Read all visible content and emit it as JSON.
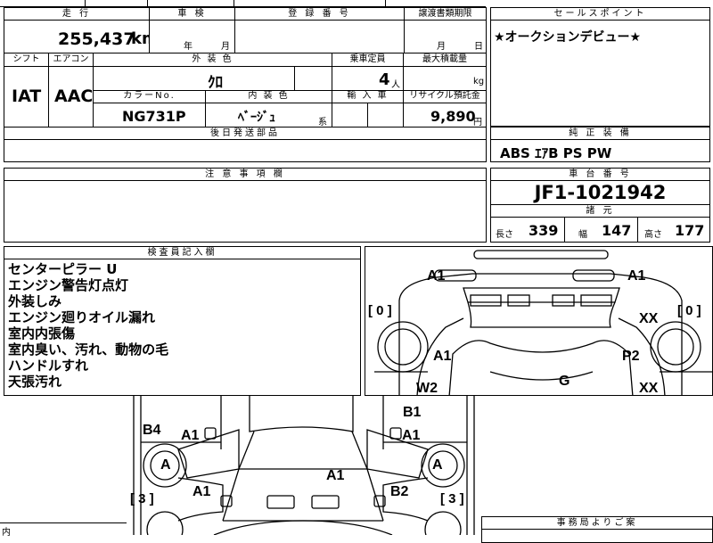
{
  "top_row": {
    "mileage_label": "走 行",
    "mileage_value": "255,437",
    "mileage_unit": "km",
    "inspection_label": "車 検",
    "inspection_year": "年",
    "inspection_month": "月",
    "registration_label": "登 録 番 号",
    "transfer_deadline_label": "譲渡書類期限",
    "transfer_month": "月",
    "transfer_day": "日"
  },
  "sales_point": {
    "header": "セールスポイント",
    "text": "★オークションデビュー★"
  },
  "specs": {
    "shift_label": "シフト",
    "shift_value": "IAT",
    "aircon_label": "エアコン",
    "aircon_value": "AAC",
    "exterior_color_label": "外 装 色",
    "exterior_color_value": "ｸﾛ",
    "capacity_label": "乗車定員",
    "capacity_value": "4",
    "capacity_unit": "人",
    "max_load_label": "最大積載量",
    "max_load_unit": "kg",
    "color_no_label": "カラーNo.",
    "color_no_value": "NG731P",
    "interior_color_label": "内 装 色",
    "interior_color_value": "ﾍﾞｰｼﾞｭ",
    "interior_color_suffix": "系",
    "import_label": "輸 入 車",
    "recycle_label": "リサイクル預託金",
    "recycle_value": "9,890",
    "recycle_unit": "円"
  },
  "later_parts": {
    "header": "後日発送部品"
  },
  "genuine_equipment": {
    "header": "純 正 装 備",
    "value": "ABS ｴｱB PS PW"
  },
  "caution": {
    "header": "注 意 事 項 欄"
  },
  "chassis": {
    "header": "車 台 番 号",
    "value": "JF1-1021942"
  },
  "dimensions": {
    "header": "諸 元",
    "length_label": "長さ",
    "length_value": "339",
    "width_label": "幅",
    "width_value": "147",
    "height_label": "高さ",
    "height_value": "177"
  },
  "inspector": {
    "header": "検査員記入欄",
    "notes": [
      "センターピラー U",
      "エンジン警告灯点灯",
      "外装しみ",
      "エンジン廻りオイル漏れ",
      "室内内張傷",
      "室内臭い、汚れ、動物の毛",
      "ハンドルすれ",
      "天張汚れ"
    ]
  },
  "diagram_marks": {
    "top_a1_left": "A1",
    "top_a1_right": "A1",
    "tire_front_left": "[ 0 ]",
    "tire_front_right": "[ 0 ]",
    "xx_upper": "XX",
    "a1_front_left": "A1",
    "p2": "P2",
    "g": "G",
    "w2": "W2",
    "xx_lower": "XX",
    "b4": "B4",
    "a1_side_left": "A1",
    "b1": "B1",
    "a1_side_right": "A1",
    "a_left": "A",
    "a_right": "A",
    "a1_roof": "A1",
    "a1_lower_left": "A1",
    "b2": "B2",
    "tire_rear_left": "[ 3 ]",
    "tire_rear_right": "[ 3 ]"
  },
  "office": {
    "header": "事務局よりご案",
    "bottom_left_label": "内"
  }
}
